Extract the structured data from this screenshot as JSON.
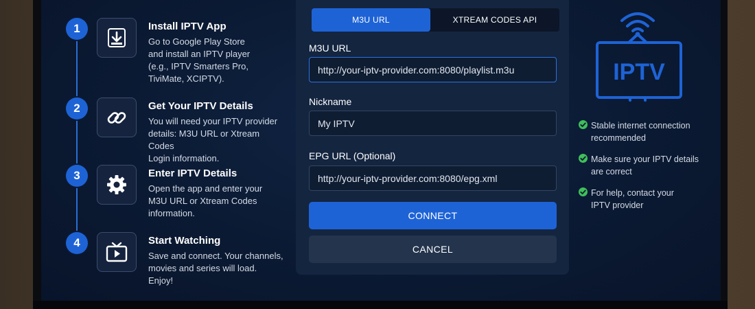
{
  "steps": [
    {
      "number": "1",
      "title": "Install IPTV App",
      "lines": [
        "Go to Google Play Store",
        "and install an IPTV player",
        "(e.g., IPTV Smarters Pro,",
        "TiviMate, XCIPTV)."
      ],
      "icon": "download-icon"
    },
    {
      "number": "2",
      "title": "Get Your IPTV Details",
      "lines": [
        "You will need your IPTV provider",
        "details: M3U URL or Xtream Codes",
        "Login information."
      ],
      "icon": "link-icon"
    },
    {
      "number": "3",
      "title": "Enter IPTV Details",
      "lines": [
        "Open the app and enter your",
        "M3U URL or Xtream Codes",
        "information."
      ],
      "icon": "gear-icon"
    },
    {
      "number": "4",
      "title": "Start Watching",
      "lines": [
        "Save and connect. Your channels,",
        "movies and series will load.",
        "Enjoy!"
      ],
      "icon": "tv-play-icon"
    }
  ],
  "form": {
    "tabs": [
      {
        "label": "M3U URL",
        "active": true
      },
      {
        "label": "XTREAM CODES API",
        "active": false
      }
    ],
    "m3u": {
      "label": "M3U URL",
      "value": "http://your-iptv-provider.com:8080/playlist.m3u"
    },
    "nickname": {
      "label": "Nickname",
      "value": "My IPTV"
    },
    "epg": {
      "label": "EPG URL (Optional)",
      "value": "http://your-iptv-provider.com:8080/epg.xml"
    },
    "connect_label": "CONNECT",
    "cancel_label": "CANCEL"
  },
  "tv_logo": {
    "text": "IPTV",
    "icon": "tv-wifi-icon"
  },
  "checklist": [
    {
      "lines": [
        "Stable internet connection",
        "recommended"
      ],
      "icon": "check-icon"
    },
    {
      "lines": [
        "Make sure your IPTV details",
        "are correct"
      ],
      "icon": "check-icon"
    },
    {
      "lines": [
        "For help, contact your",
        "IPTV provider"
      ],
      "icon": "check-icon"
    }
  ],
  "colors": {
    "accent": "#1e63d6",
    "check": "#3fbf5a",
    "logo_blue": "#1e63d6"
  }
}
